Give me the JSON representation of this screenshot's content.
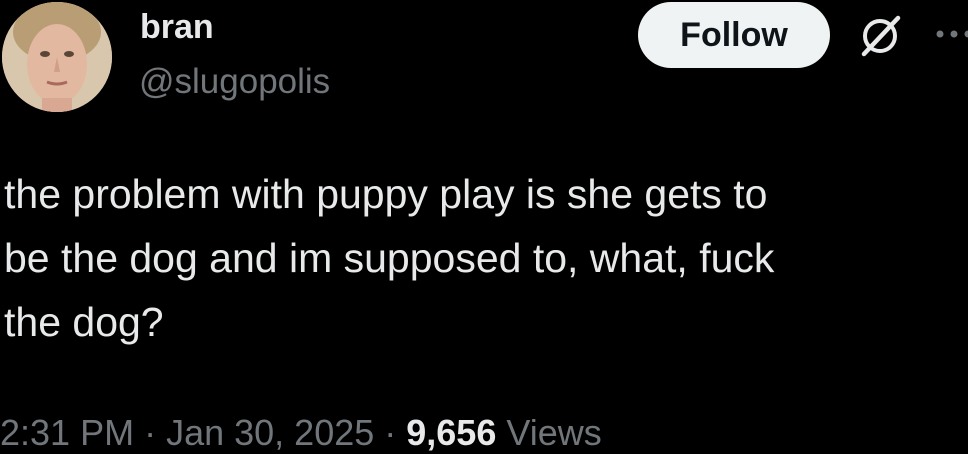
{
  "user": {
    "display_name": "bran",
    "handle": "@slugopolis",
    "avatar_icon": "profile-photo"
  },
  "actions": {
    "follow_label": "Follow",
    "grok_icon": "grok-icon",
    "more_icon": "more-options-icon"
  },
  "tweet": {
    "lines": [
      "the problem with puppy play is she gets to",
      "be the dog and im supposed to, what, fuck",
      "the dog?"
    ]
  },
  "meta": {
    "time": "2:31 PM",
    "separator": " · ",
    "date": "Jan 30, 2025",
    "views_count": "9,656",
    "views_label": "Views"
  },
  "colors": {
    "background": "#000000",
    "primary_text": "#e7e9ea",
    "secondary_text": "#71767b",
    "follow_button_bg": "#eff3f4",
    "follow_button_text": "#0f1419"
  }
}
